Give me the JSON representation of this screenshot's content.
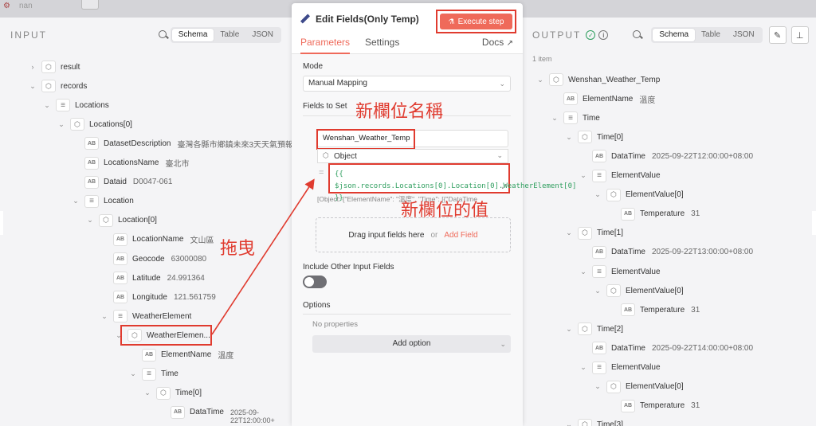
{
  "topbar": {
    "app_name": "nan"
  },
  "input": {
    "title": "INPUT",
    "views": [
      "Schema",
      "Table",
      "JSON"
    ],
    "active_view": "Schema",
    "tree": [
      {
        "depth": 0,
        "chevron": "›",
        "type": "obj",
        "key": "result",
        "value": ""
      },
      {
        "depth": 0,
        "chevron": "⌄",
        "type": "obj",
        "key": "records",
        "value": ""
      },
      {
        "depth": 1,
        "chevron": "⌄",
        "type": "arr",
        "key": "Locations",
        "value": ""
      },
      {
        "depth": 2,
        "chevron": "⌄",
        "type": "obj",
        "key": "Locations[0]",
        "value": ""
      },
      {
        "depth": 3,
        "chevron": "",
        "type": "str",
        "key": "DatasetDescription",
        "value": "臺灣各縣市鄉鎮未來3天天氣預報"
      },
      {
        "depth": 3,
        "chevron": "",
        "type": "str",
        "key": "LocationsName",
        "value": "臺北市"
      },
      {
        "depth": 3,
        "chevron": "",
        "type": "str",
        "key": "Dataid",
        "value": "D0047-061"
      },
      {
        "depth": 3,
        "chevron": "⌄",
        "type": "arr",
        "key": "Location",
        "value": ""
      },
      {
        "depth": 4,
        "chevron": "⌄",
        "type": "obj",
        "key": "Location[0]",
        "value": ""
      },
      {
        "depth": 5,
        "chevron": "",
        "type": "str",
        "key": "LocationName",
        "value": "文山區"
      },
      {
        "depth": 5,
        "chevron": "",
        "type": "str",
        "key": "Geocode",
        "value": "63000080"
      },
      {
        "depth": 5,
        "chevron": "",
        "type": "str",
        "key": "Latitude",
        "value": "24.991364"
      },
      {
        "depth": 5,
        "chevron": "",
        "type": "str",
        "key": "Longitude",
        "value": "121.561759"
      },
      {
        "depth": 5,
        "chevron": "⌄",
        "type": "arr",
        "key": "WeatherElement",
        "value": ""
      },
      {
        "depth": 6,
        "chevron": "⌄",
        "type": "obj",
        "key": "WeatherElemen...",
        "value": ""
      },
      {
        "depth": 7,
        "chevron": "",
        "type": "str",
        "key": "ElementName",
        "value": "溫度"
      },
      {
        "depth": 7,
        "chevron": "⌄",
        "type": "arr",
        "key": "Time",
        "value": ""
      },
      {
        "depth": 8,
        "chevron": "⌄",
        "type": "obj",
        "key": "Time[0]",
        "value": ""
      },
      {
        "depth": 9,
        "chevron": "",
        "type": "str",
        "key": "DataTime",
        "value": "2025-09-22T12:00:00+"
      }
    ],
    "last_value_wrap": "22T12:00:00+"
  },
  "node": {
    "title": "Edit Fields(Only Temp)",
    "execute_label": "Execute step",
    "tabs": [
      "Parameters",
      "Settings"
    ],
    "active_tab": "Parameters",
    "docs_label": "Docs",
    "mode_label": "Mode",
    "mode_value": "Manual Mapping",
    "fields_label": "Fields to Set",
    "field_name": "Wenshan_Weather_Temp",
    "field_type": "Object",
    "field_expression": "{{ $json.records.Locations[0].Location[0].WeatherElement[0] }}",
    "field_preview": "[Object: {\"ElementName\": \"溫度\", \"Time\": [{\"DataTime",
    "drop_text": "Drag input fields here",
    "drop_or": "or",
    "drop_add": "Add Field",
    "include_label": "Include Other Input Fields",
    "include_on": false,
    "options_label": "Options",
    "no_props": "No properties",
    "add_option": "Add option"
  },
  "annotations": {
    "new_field_name": "新欄位名稱",
    "new_field_value": "新欄位的值",
    "drag": "拖曳",
    "color": "#e03b2f"
  },
  "output": {
    "title": "OUTPUT",
    "item_count": "1 item",
    "views": [
      "Schema",
      "Table",
      "JSON"
    ],
    "active_view": "Schema",
    "tree": [
      {
        "depth": 0,
        "chevron": "⌄",
        "type": "obj",
        "key": "Wenshan_Weather_Temp",
        "value": ""
      },
      {
        "depth": 1,
        "chevron": "",
        "type": "str",
        "key": "ElementName",
        "value": "溫度"
      },
      {
        "depth": 1,
        "chevron": "⌄",
        "type": "arr",
        "key": "Time",
        "value": ""
      },
      {
        "depth": 2,
        "chevron": "⌄",
        "type": "obj",
        "key": "Time[0]",
        "value": ""
      },
      {
        "depth": 3,
        "chevron": "",
        "type": "str",
        "key": "DataTime",
        "value": "2025-09-22T12:00:00+08:00"
      },
      {
        "depth": 3,
        "chevron": "⌄",
        "type": "arr",
        "key": "ElementValue",
        "value": ""
      },
      {
        "depth": 4,
        "chevron": "⌄",
        "type": "obj",
        "key": "ElementValue[0]",
        "value": ""
      },
      {
        "depth": 5,
        "chevron": "",
        "type": "str",
        "key": "Temperature",
        "value": "31"
      },
      {
        "depth": 2,
        "chevron": "⌄",
        "type": "obj",
        "key": "Time[1]",
        "value": ""
      },
      {
        "depth": 3,
        "chevron": "",
        "type": "str",
        "key": "DataTime",
        "value": "2025-09-22T13:00:00+08:00"
      },
      {
        "depth": 3,
        "chevron": "⌄",
        "type": "arr",
        "key": "ElementValue",
        "value": ""
      },
      {
        "depth": 4,
        "chevron": "⌄",
        "type": "obj",
        "key": "ElementValue[0]",
        "value": ""
      },
      {
        "depth": 5,
        "chevron": "",
        "type": "str",
        "key": "Temperature",
        "value": "31"
      },
      {
        "depth": 2,
        "chevron": "⌄",
        "type": "obj",
        "key": "Time[2]",
        "value": ""
      },
      {
        "depth": 3,
        "chevron": "",
        "type": "str",
        "key": "DataTime",
        "value": "2025-09-22T14:00:00+08:00"
      },
      {
        "depth": 3,
        "chevron": "⌄",
        "type": "arr",
        "key": "ElementValue",
        "value": ""
      },
      {
        "depth": 4,
        "chevron": "⌄",
        "type": "obj",
        "key": "ElementValue[0]",
        "value": ""
      },
      {
        "depth": 5,
        "chevron": "",
        "type": "str",
        "key": "Temperature",
        "value": "31"
      },
      {
        "depth": 2,
        "chevron": "⌄",
        "type": "obj",
        "key": "Time[3]",
        "value": ""
      }
    ]
  }
}
